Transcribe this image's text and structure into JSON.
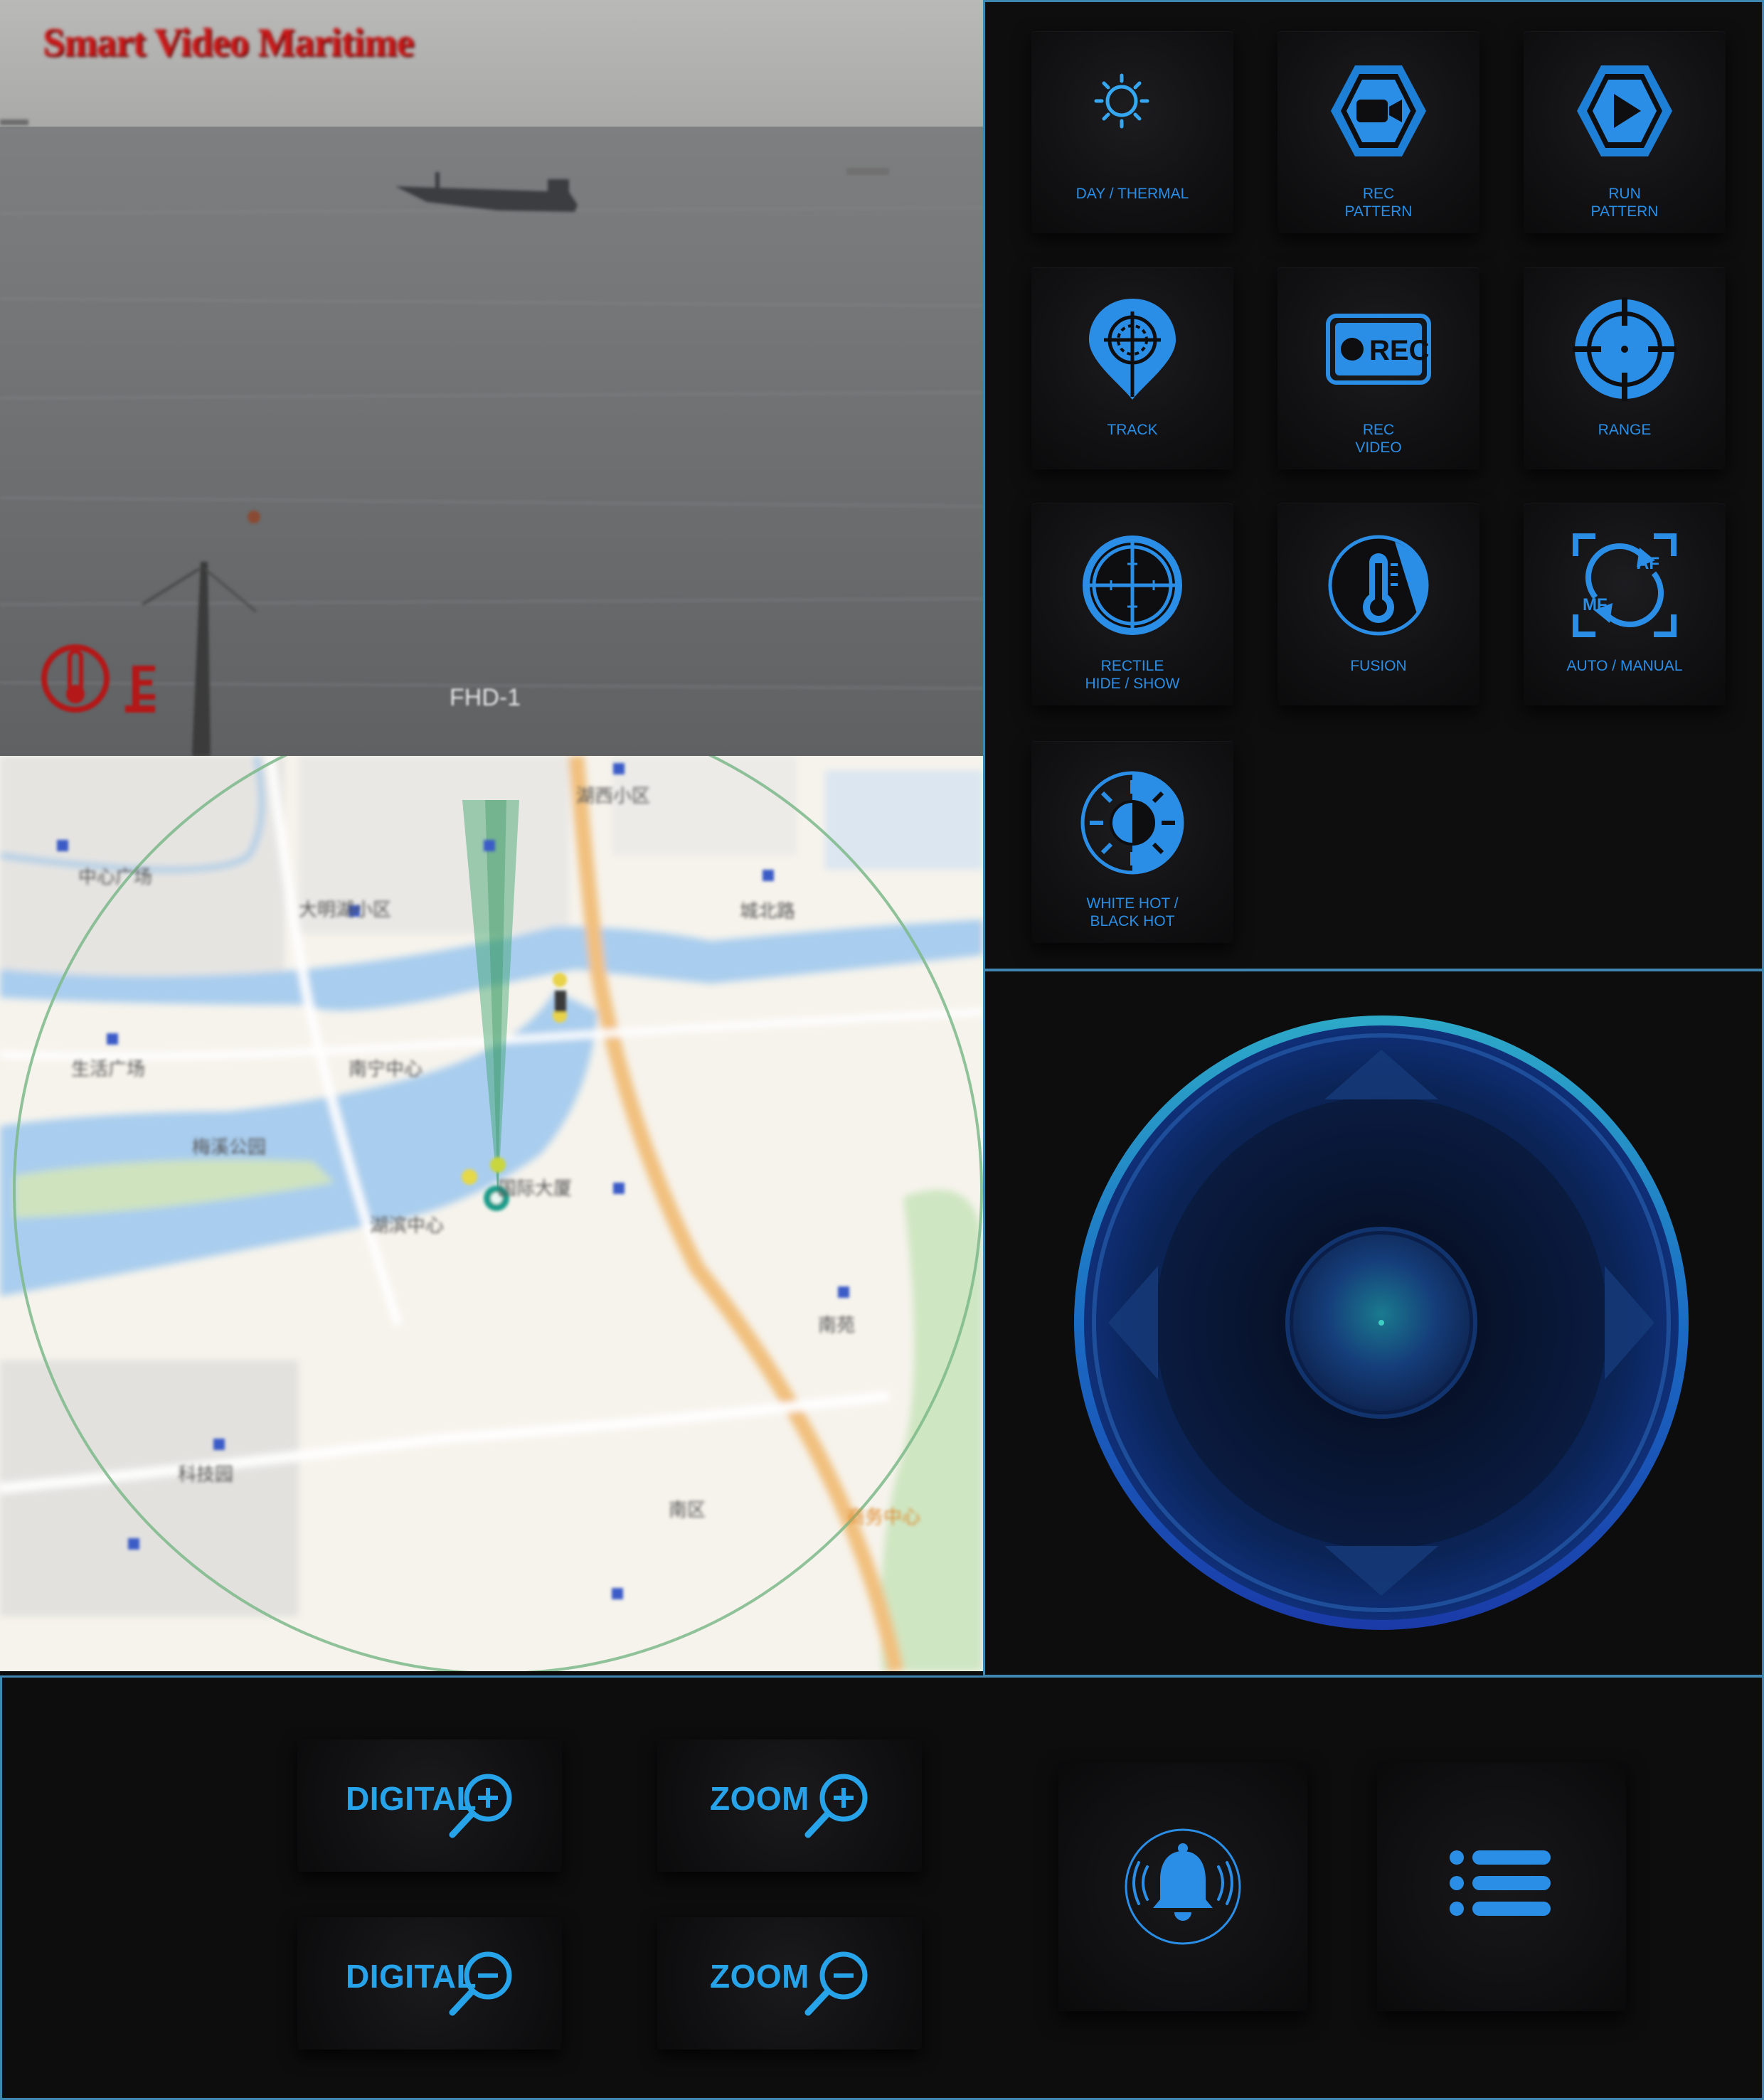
{
  "video": {
    "watermark": "Smart Video Maritime",
    "overlay_text": "FHD-1",
    "thermal_indicator_icon": "thermometer-icon"
  },
  "map": {
    "labels": [
      "中心广场",
      "大明湖小区",
      "南宁中心",
      "湖滨中心",
      "生活广场",
      "国际大厦",
      "城北路",
      "南区",
      "梅溪公园",
      "湖西小区",
      "科技园",
      "南苑",
      "商务中心"
    ]
  },
  "controls": [
    {
      "id": "day-thermal",
      "label": "DAY / THERMAL",
      "icon": "day-night-icon"
    },
    {
      "id": "rec-pattern",
      "label": "REC\nPATTERN",
      "icon": "camera-hexagon-icon"
    },
    {
      "id": "run-pattern",
      "label": "RUN\nPATTERN",
      "icon": "play-hexagon-icon"
    },
    {
      "id": "track",
      "label": "TRACK",
      "icon": "track-pin-icon"
    },
    {
      "id": "rec-video",
      "label": "REC\nVIDEO",
      "icon": "rec-icon"
    },
    {
      "id": "range",
      "label": "RANGE",
      "icon": "target-icon"
    },
    {
      "id": "rectile",
      "label": "RECTILE\nHIDE / SHOW",
      "icon": "crosshair-icon"
    },
    {
      "id": "fusion",
      "label": "FUSION",
      "icon": "thermometer-icon"
    },
    {
      "id": "auto-manual",
      "label": "AUTO / MANUAL",
      "icon": "af-mf-icon"
    },
    {
      "id": "white-black",
      "label": "WHITE HOT /\nBLACK HOT",
      "icon": "contrast-sun-icon"
    }
  ],
  "rec_icon_text": "REC",
  "af_text": "AF",
  "mf_text": "MF",
  "zoom": {
    "digital_in": "DIGITAL",
    "zoom_in": "ZOOM",
    "digital_out": "DIGITAL",
    "zoom_out": "ZOOM"
  },
  "actions": {
    "alarm_icon": "bell-icon",
    "menu_icon": "list-icon"
  },
  "colors": {
    "accent": "#2b8ee6",
    "accent_light": "#31b6f0",
    "frame": "#3f86b0",
    "background": "#0d0d0e"
  }
}
